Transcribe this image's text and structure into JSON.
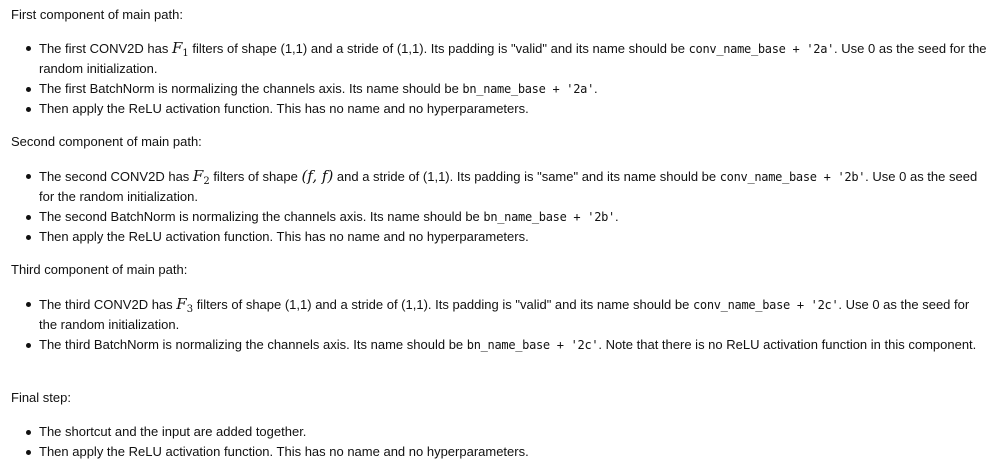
{
  "sections": [
    {
      "title": "First component of main path:",
      "items": [
        {
          "a": "The first CONV2D has ",
          "math": "F",
          "sub": "1",
          "b": " filters of shape (1,1) and a stride of (1,1). Its padding is \"valid\" and its name should be ",
          "code": "conv_name_base + '2a'",
          "c": ". Use 0 as the seed for the random initialization."
        },
        {
          "a": "The first BatchNorm is normalizing the channels axis. Its name should be ",
          "code": "bn_name_base + '2a'",
          "c": "."
        },
        {
          "a": "Then apply the ReLU activation function. This has no name and no hyperparameters."
        }
      ]
    },
    {
      "title": "Second component of main path:",
      "items": [
        {
          "a": "The second CONV2D has ",
          "math": "F",
          "sub": "2",
          "b1": " filters of shape ",
          "math2": "(f, f)",
          "b2": " and a stride of (1,1). Its padding is \"same\" and its name should be ",
          "code": "conv_name_base + '2b'",
          "c": ". Use 0 as the seed for the random initialization."
        },
        {
          "a": "The second BatchNorm is normalizing the channels axis. Its name should be ",
          "code": "bn_name_base + '2b'",
          "c": "."
        },
        {
          "a": "Then apply the ReLU activation function. This has no name and no hyperparameters."
        }
      ]
    },
    {
      "title": "Third component of main path:",
      "items": [
        {
          "a": "The third CONV2D has ",
          "math": "F",
          "sub": "3",
          "b": " filters of shape (1,1) and a stride of (1,1). Its padding is \"valid\" and its name should be ",
          "code": "conv_name_base + '2c'",
          "c": ". Use 0 as the seed for the random initialization."
        },
        {
          "a": "The third BatchNorm is normalizing the channels axis. Its name should be ",
          "code": "bn_name_base + '2c'",
          "c": ". Note that there is no ReLU activation function in this component."
        }
      ]
    },
    {
      "title": "Final step:",
      "items": [
        {
          "a": "The shortcut and the input are added together."
        },
        {
          "a": "Then apply the ReLU activation function. This has no name and no hyperparameters."
        }
      ]
    }
  ]
}
